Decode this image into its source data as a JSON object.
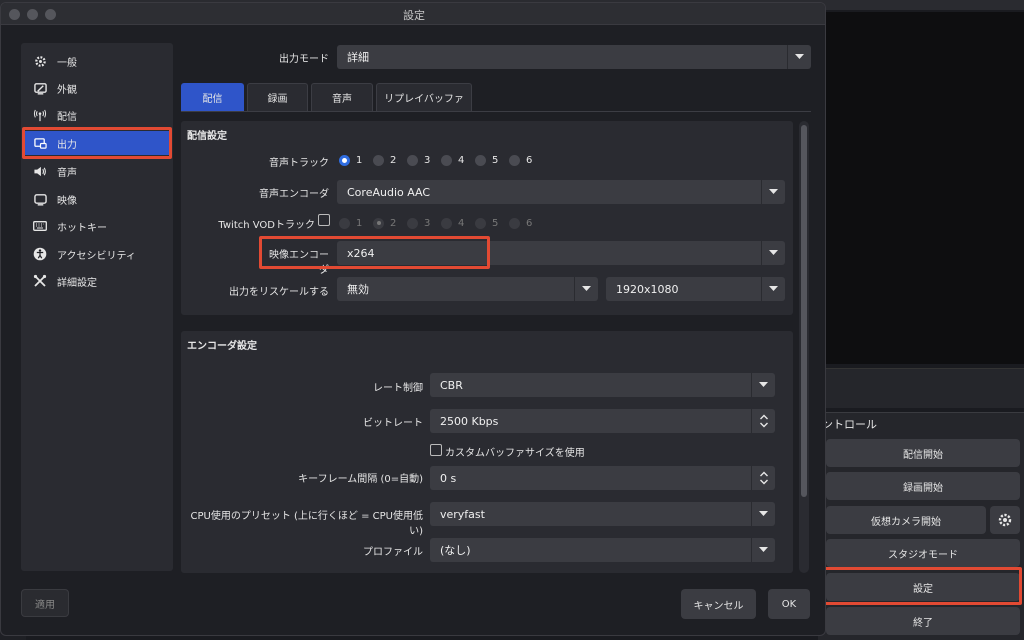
{
  "window": {
    "title": "設定"
  },
  "sidebar": {
    "items": [
      {
        "label": "一般",
        "icon": "gear-icon"
      },
      {
        "label": "外観",
        "icon": "appearance-icon"
      },
      {
        "label": "配信",
        "icon": "broadcast-icon"
      },
      {
        "label": "出力",
        "icon": "output-icon",
        "active": true
      },
      {
        "label": "音声",
        "icon": "speaker-icon"
      },
      {
        "label": "映像",
        "icon": "monitor-icon"
      },
      {
        "label": "ホットキー",
        "icon": "keyboard-icon"
      },
      {
        "label": "アクセシビリティ",
        "icon": "accessibility-icon"
      },
      {
        "label": "詳細設定",
        "icon": "tools-icon"
      }
    ]
  },
  "output_mode": {
    "label": "出力モード",
    "value": "詳細"
  },
  "tabs": [
    {
      "label": "配信",
      "active": true
    },
    {
      "label": "録画"
    },
    {
      "label": "音声"
    },
    {
      "label": "リプレイバッファ"
    }
  ],
  "stream_settings": {
    "title": "配信設定",
    "audio_track": {
      "label": "音声トラック",
      "options": [
        "1",
        "2",
        "3",
        "4",
        "5",
        "6"
      ],
      "selected": "1"
    },
    "audio_encoder": {
      "label": "音声エンコーダ",
      "value": "CoreAudio AAC"
    },
    "twitch_vod": {
      "label": "Twitch VODトラック",
      "options": [
        "1",
        "2",
        "3",
        "4",
        "5",
        "6"
      ],
      "selected": "2"
    },
    "video_encoder": {
      "label": "映像エンコーダ",
      "value": "x264"
    },
    "rescale": {
      "label": "出力をリスケールする",
      "value": "無効",
      "resolution": "1920x1080"
    }
  },
  "encoder_settings": {
    "title": "エンコーダ設定",
    "rate_control": {
      "label": "レート制御",
      "value": "CBR"
    },
    "bitrate": {
      "label": "ビットレート",
      "value": "2500 Kbps"
    },
    "custom_buffer": {
      "label": "カスタムバッファサイズを使用"
    },
    "keyframe": {
      "label": "キーフレーム間隔 (0=自動)",
      "value": "0 s"
    },
    "cpu_preset": {
      "label": "CPU使用のプリセット (上に行くほど = CPU使用低い)",
      "value": "veryfast"
    },
    "profile": {
      "label": "プロファイル",
      "value": "(なし)"
    }
  },
  "footer": {
    "apply": "適用",
    "cancel": "キャンセル",
    "ok": "OK"
  },
  "controls": {
    "title": "ントロール",
    "buttons": [
      "配信開始",
      "録画開始",
      "仮想カメラ開始",
      "スタジオモード",
      "設定",
      "終了"
    ]
  },
  "colors": {
    "accent": "#2f55c9",
    "highlight": "#e24a33",
    "background": "#1e1f24"
  }
}
